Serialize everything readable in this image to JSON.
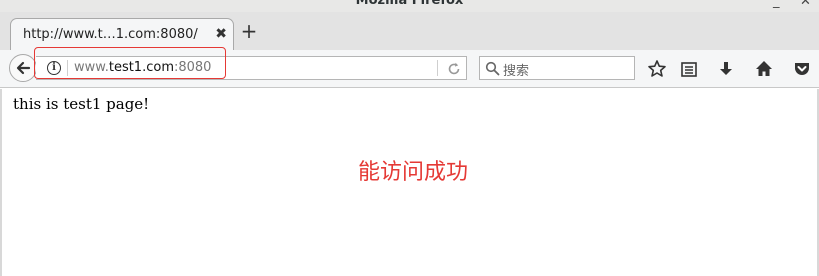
{
  "window": {
    "title": "Mozilla Firefox"
  },
  "tab": {
    "title": "http://www.t…1.com:8080/",
    "close_glyph": "✖"
  },
  "new_tab_glyph": "+",
  "urlbar": {
    "prefix": "www.",
    "host": "test1.com",
    "port": ":8080"
  },
  "search": {
    "placeholder": "搜索"
  },
  "content": {
    "text": "this is test1 page!"
  },
  "annotation": {
    "text": "能访问成功",
    "color": "#e53935"
  },
  "icons": [
    "back-icon",
    "info-icon",
    "reload-icon",
    "search-icon",
    "bookmark-star-icon",
    "reading-list-icon",
    "download-icon",
    "home-icon",
    "pocket-icon"
  ]
}
